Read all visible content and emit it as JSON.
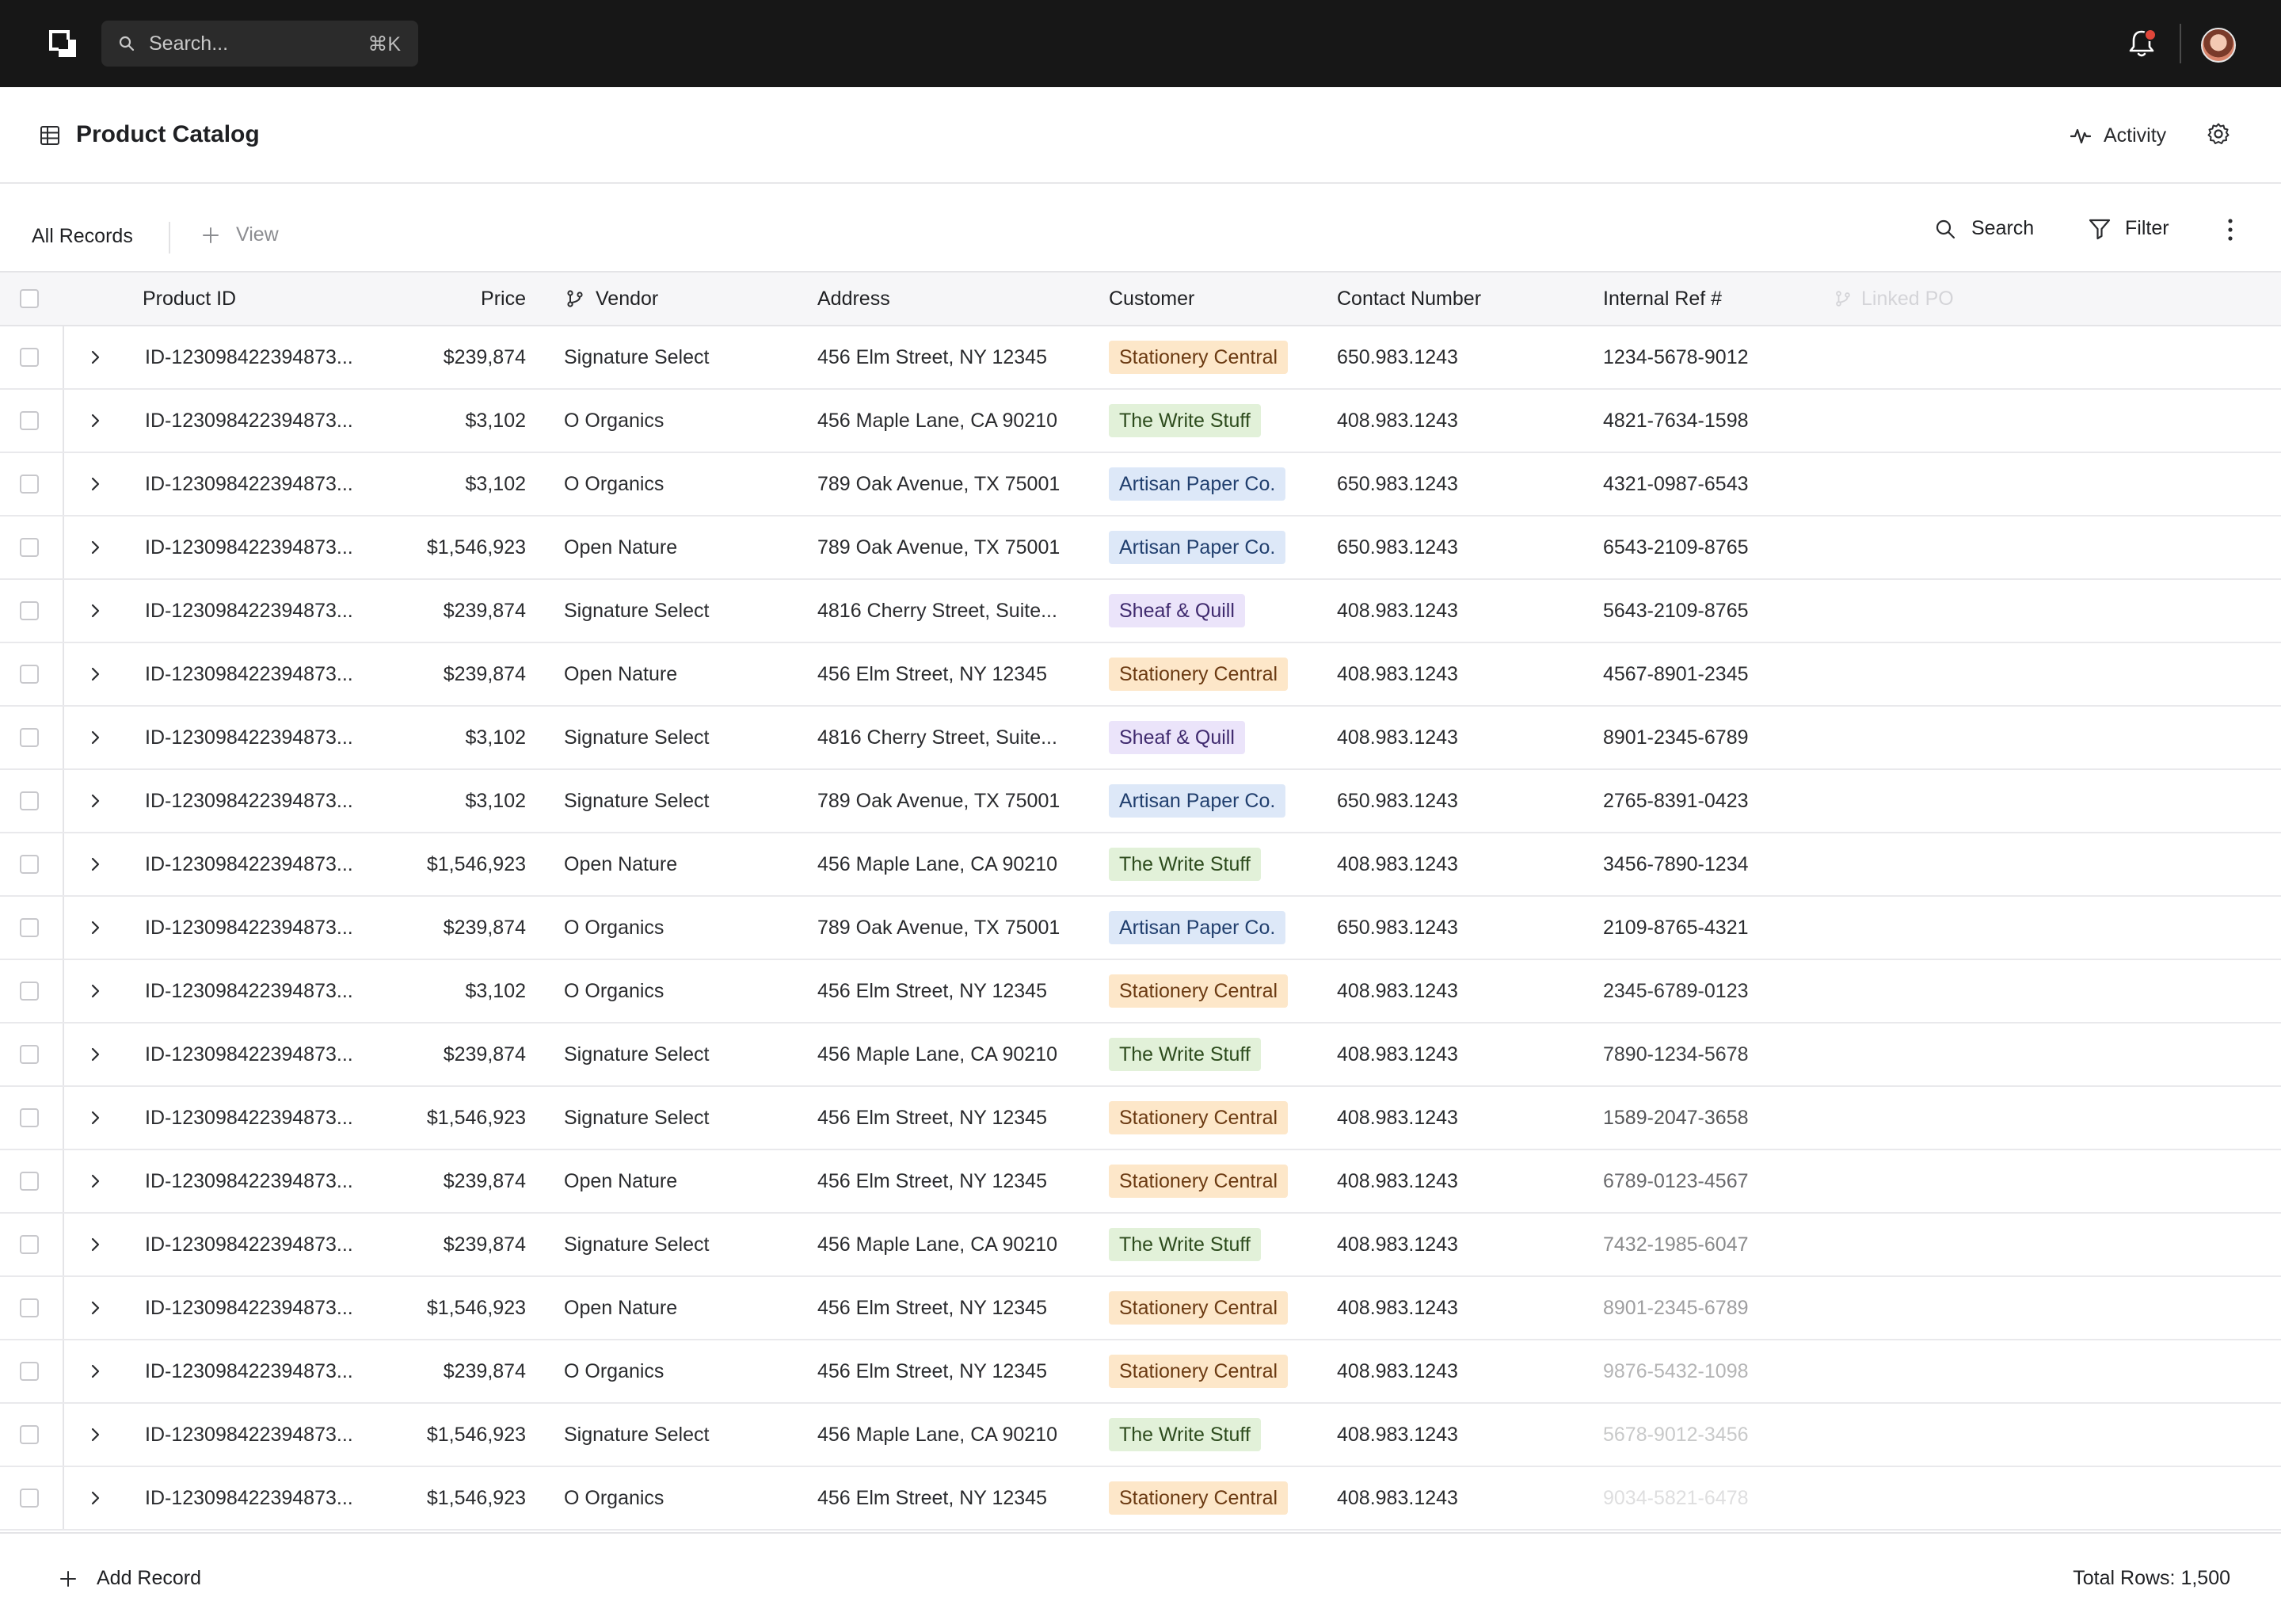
{
  "topbar": {
    "search_placeholder": "Search...",
    "search_shortcut": "⌘K",
    "notification_dot_color": "#e0463a"
  },
  "page": {
    "title": "Product Catalog",
    "activity_label": "Activity"
  },
  "toolbar": {
    "all_records_label": "All Records",
    "add_view_label": "View",
    "search_label": "Search",
    "filter_label": "Filter"
  },
  "table": {
    "columns": {
      "product_id": "Product ID",
      "price": "Price",
      "vendor": "Vendor",
      "address": "Address",
      "customer": "Customer",
      "contact": "Contact Number",
      "internal_ref": "Internal Ref #",
      "linked_po": "Linked PO"
    },
    "tag_colors": {
      "orange": "#fde7c9",
      "green": "#e2f1d9",
      "blue": "#dde8f8",
      "purple": "#ebe4fa"
    },
    "rows": [
      {
        "id": "ID-123098422394873...",
        "price": "$239,874",
        "vendor": "Signature Select",
        "address": "456 Elm Street, NY 12345",
        "customer": "Stationery Central",
        "tag": "orange",
        "contact": "650.983.1243",
        "ref": "1234-5678-9012",
        "ref_opacity": 1
      },
      {
        "id": "ID-123098422394873...",
        "price": "$3,102",
        "vendor": "O Organics",
        "address": "456 Maple Lane, CA 90210",
        "customer": "The Write Stuff",
        "tag": "green",
        "contact": "408.983.1243",
        "ref": "4821-7634-1598",
        "ref_opacity": 1
      },
      {
        "id": "ID-123098422394873...",
        "price": "$3,102",
        "vendor": "O Organics",
        "address": "789 Oak Avenue, TX 75001",
        "customer": "Artisan Paper Co.",
        "tag": "blue",
        "contact": "650.983.1243",
        "ref": "4321-0987-6543",
        "ref_opacity": 1
      },
      {
        "id": "ID-123098422394873...",
        "price": "$1,546,923",
        "vendor": "Open Nature",
        "address": "789 Oak Avenue, TX 75001",
        "customer": "Artisan Paper Co.",
        "tag": "blue",
        "contact": "650.983.1243",
        "ref": "6543-2109-8765",
        "ref_opacity": 1
      },
      {
        "id": "ID-123098422394873...",
        "price": "$239,874",
        "vendor": "Signature Select",
        "address": "4816 Cherry Street, Suite...",
        "customer": "Sheaf & Quill",
        "tag": "purple",
        "contact": "408.983.1243",
        "ref": "5643-2109-8765",
        "ref_opacity": 1
      },
      {
        "id": "ID-123098422394873...",
        "price": "$239,874",
        "vendor": "Open Nature",
        "address": "456 Elm Street, NY 12345",
        "customer": "Stationery Central",
        "tag": "orange",
        "contact": "408.983.1243",
        "ref": "4567-8901-2345",
        "ref_opacity": 1
      },
      {
        "id": "ID-123098422394873...",
        "price": "$3,102",
        "vendor": "Signature Select",
        "address": "4816 Cherry Street, Suite...",
        "customer": "Sheaf & Quill",
        "tag": "purple",
        "contact": "408.983.1243",
        "ref": "8901-2345-6789",
        "ref_opacity": 1
      },
      {
        "id": "ID-123098422394873...",
        "price": "$3,102",
        "vendor": "Signature Select",
        "address": "789 Oak Avenue, TX 75001",
        "customer": "Artisan Paper Co.",
        "tag": "blue",
        "contact": "650.983.1243",
        "ref": "2765-8391-0423",
        "ref_opacity": 1
      },
      {
        "id": "ID-123098422394873...",
        "price": "$1,546,923",
        "vendor": "Open Nature",
        "address": "456 Maple Lane, CA 90210",
        "customer": "The Write Stuff",
        "tag": "green",
        "contact": "408.983.1243",
        "ref": "3456-7890-1234",
        "ref_opacity": 1
      },
      {
        "id": "ID-123098422394873...",
        "price": "$239,874",
        "vendor": "O Organics",
        "address": "789 Oak Avenue, TX 75001",
        "customer": "Artisan Paper Co.",
        "tag": "blue",
        "contact": "650.983.1243",
        "ref": "2109-8765-4321",
        "ref_opacity": 1
      },
      {
        "id": "ID-123098422394873...",
        "price": "$3,102",
        "vendor": "O Organics",
        "address": "456 Elm Street, NY 12345",
        "customer": "Stationery Central",
        "tag": "orange",
        "contact": "408.983.1243",
        "ref": "2345-6789-0123",
        "ref_opacity": 0.95
      },
      {
        "id": "ID-123098422394873...",
        "price": "$239,874",
        "vendor": "Signature Select",
        "address": "456 Maple Lane, CA 90210",
        "customer": "The Write Stuff",
        "tag": "green",
        "contact": "408.983.1243",
        "ref": "7890-1234-5678",
        "ref_opacity": 0.9
      },
      {
        "id": "ID-123098422394873...",
        "price": "$1,546,923",
        "vendor": "Signature Select",
        "address": "456 Elm Street, NY 12345",
        "customer": "Stationery Central",
        "tag": "orange",
        "contact": "408.983.1243",
        "ref": "1589-2047-3658",
        "ref_opacity": 0.8
      },
      {
        "id": "ID-123098422394873...",
        "price": "$239,874",
        "vendor": "Open Nature",
        "address": "456 Elm Street, NY 12345",
        "customer": "Stationery Central",
        "tag": "orange",
        "contact": "408.983.1243",
        "ref": "6789-0123-4567",
        "ref_opacity": 0.7
      },
      {
        "id": "ID-123098422394873...",
        "price": "$239,874",
        "vendor": "Signature Select",
        "address": "456 Maple Lane, CA 90210",
        "customer": "The Write Stuff",
        "tag": "green",
        "contact": "408.983.1243",
        "ref": "7432-1985-6047",
        "ref_opacity": 0.55
      },
      {
        "id": "ID-123098422394873...",
        "price": "$1,546,923",
        "vendor": "Open Nature",
        "address": "456 Elm Street, NY 12345",
        "customer": "Stationery Central",
        "tag": "orange",
        "contact": "408.983.1243",
        "ref": "8901-2345-6789",
        "ref_opacity": 0.45
      },
      {
        "id": "ID-123098422394873...",
        "price": "$239,874",
        "vendor": "O Organics",
        "address": "456 Elm Street, NY 12345",
        "customer": "Stationery Central",
        "tag": "orange",
        "contact": "408.983.1243",
        "ref": "9876-5432-1098",
        "ref_opacity": 0.35
      },
      {
        "id": "ID-123098422394873...",
        "price": "$1,546,923",
        "vendor": "Signature Select",
        "address": "456 Maple Lane, CA 90210",
        "customer": "The Write Stuff",
        "tag": "green",
        "contact": "408.983.1243",
        "ref": "5678-9012-3456",
        "ref_opacity": 0.25
      },
      {
        "id": "ID-123098422394873...",
        "price": "$1,546,923",
        "vendor": "O Organics",
        "address": "456 Elm Street, NY 12345",
        "customer": "Stationery Central",
        "tag": "orange",
        "contact": "408.983.1243",
        "ref": "9034-5821-6478",
        "ref_opacity": 0.15
      }
    ]
  },
  "footer": {
    "add_record_label": "Add Record",
    "total_rows_label": "Total Rows: 1,500"
  }
}
